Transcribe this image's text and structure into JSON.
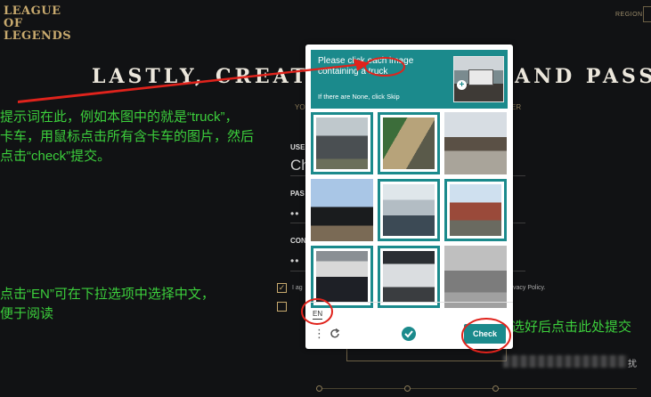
{
  "colors": {
    "accent": "#1b8a8c",
    "gold": "#c8aa6e",
    "annotation_green": "#3ccf3c",
    "annotation_red": "#e0231c",
    "background": "#111214"
  },
  "page": {
    "logo_line1": "LEAGUE OF",
    "logo_line2": "LEGENDS",
    "region_label": "REGION:",
    "headline_left": "LASTLY, CREATE",
    "headline_right": "AND PASSW",
    "subtitle_left": "YO",
    "subtitle_right": "ER",
    "username_label": "USE",
    "username_value": "Ch",
    "password_label": "PAS",
    "password_mask": "••",
    "confirm_label": "CON",
    "confirm_mask": "••",
    "agree_text": "I ag",
    "policy_text": "vacy Policy.",
    "checkbox_mark": "✓",
    "tail_char": "扰"
  },
  "captcha": {
    "prompt_line1": "Please click each image",
    "prompt_line2": "containing a truck",
    "skip_text": "If there are None, click Skip",
    "plus_symbol": "+",
    "tiles": [
      {
        "name": "tile-1",
        "selected": true
      },
      {
        "name": "tile-2",
        "selected": true
      },
      {
        "name": "tile-3",
        "selected": false
      },
      {
        "name": "tile-4",
        "selected": false
      },
      {
        "name": "tile-5",
        "selected": true
      },
      {
        "name": "tile-6",
        "selected": true
      },
      {
        "name": "tile-7",
        "selected": true
      },
      {
        "name": "tile-8",
        "selected": true
      },
      {
        "name": "tile-9",
        "selected": false
      }
    ],
    "language": "EN",
    "menu_icon": "⋮",
    "check_label": "Check"
  },
  "annotations": {
    "line1": "提示词在此，例如本图中的就是“truck”，",
    "line2": "卡车，用鼠标点击所有含卡车的图片，然后",
    "line3": "点击“check”提交。",
    "lang_line1": "点击“EN”可在下拉选项中选择中文，",
    "lang_line2": "便于阅读",
    "check_hint": "选好后点击此处提交"
  }
}
